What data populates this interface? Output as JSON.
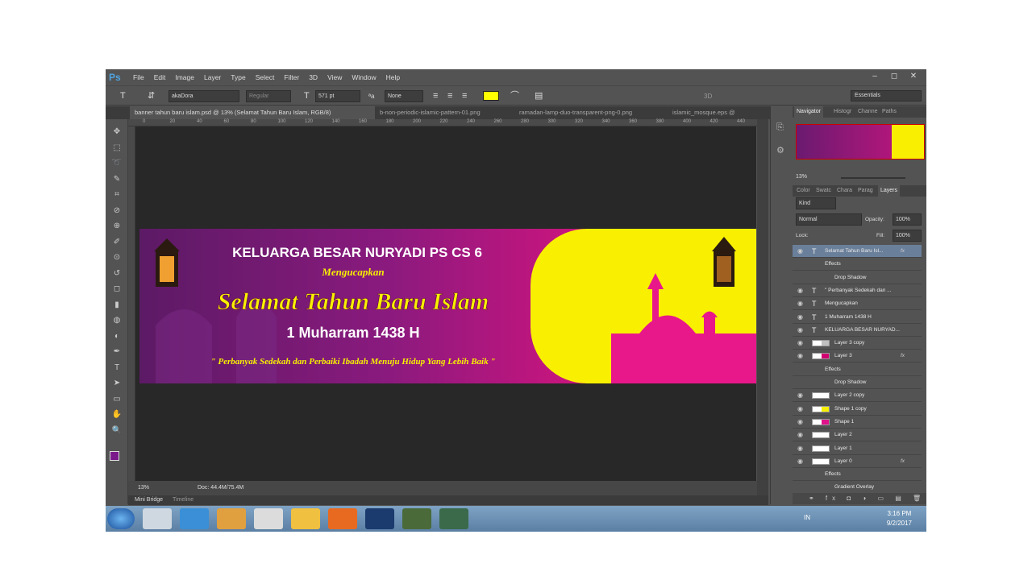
{
  "app": {
    "logo": "Ps"
  },
  "menu": [
    "File",
    "Edit",
    "Image",
    "Layer",
    "Type",
    "Select",
    "Filter",
    "3D",
    "View",
    "Window",
    "Help"
  ],
  "window_controls": [
    "–",
    "◻",
    "✕"
  ],
  "options": {
    "font_family": "akaDora",
    "font_style": "Regular",
    "font_size": "571 pt",
    "antialias": "None",
    "three_d": "3D",
    "workspace": "Essentials",
    "text_color": "#ffff00"
  },
  "doc_tabs": [
    "banner tahun baru islam.psd @ 13% (Selamat Tahun Baru Islam, RGB/8)",
    "b-non-periodic-islamic-pattern-01.png",
    "ramadan-lamp-duo-transparent-png-0.png",
    "islamic_mosque.eps @"
  ],
  "ruler_ticks": [
    "0",
    "20",
    "40",
    "60",
    "80",
    "100",
    "120",
    "140",
    "160",
    "180",
    "200",
    "220",
    "240",
    "260",
    "280",
    "300",
    "320",
    "340",
    "360",
    "380",
    "400",
    "420",
    "440"
  ],
  "banner": {
    "line1": "KELUARGA BESAR NURYADI PS CS 6",
    "line2": "Mengucapkan",
    "line3": "Selamat Tahun Baru Islam",
    "line4": "1 Muharram 1438 H",
    "line5": "\" Perbanyak Sedekah dan Perbaiki Ibadah Menuju Hidup Yang Lebih Baik \""
  },
  "status": {
    "zoom": "13%",
    "doc": "Doc: 44.4M/75.4M"
  },
  "bottom_tabs": [
    "Mini Bridge",
    "Timeline"
  ],
  "navigator": {
    "tabs": [
      "Navigator",
      "Histogr",
      "Channe",
      "Paths"
    ],
    "zoom": "13%"
  },
  "layers_panel": {
    "tabs": [
      "Color",
      "Swatc",
      "Chara",
      "Parag",
      "Layers"
    ],
    "kind": "Kind",
    "blend": "Normal",
    "opacity_label": "Opacity:",
    "opacity": "100%",
    "lock_label": "Lock:",
    "fill_label": "Fill:",
    "fill": "100%",
    "layers": [
      {
        "name": "Selamat Tahun Baru Isl...",
        "type": "text",
        "fx": "fx",
        "indent": 0,
        "selected": true
      },
      {
        "name": "Effects",
        "type": "effect",
        "fx": "",
        "indent": 1
      },
      {
        "name": "Drop Shadow",
        "type": "effect",
        "fx": "",
        "indent": 2
      },
      {
        "name": "\" Perbanyak Sedekah dan ...",
        "type": "text",
        "fx": "",
        "indent": 0
      },
      {
        "name": "Mengucapkan",
        "type": "text",
        "fx": "",
        "indent": 0
      },
      {
        "name": "1 Muharram 1438 H",
        "type": "text",
        "fx": "",
        "indent": 0
      },
      {
        "name": "KELUARGA BESAR NURYAD...",
        "type": "text",
        "fx": "",
        "indent": 0
      },
      {
        "name": "Layer 3 copy",
        "type": "image",
        "fx": "",
        "indent": 0
      },
      {
        "name": "Layer 3",
        "type": "image",
        "fx": "fx",
        "indent": 0
      },
      {
        "name": "Effects",
        "type": "effect",
        "fx": "",
        "indent": 1
      },
      {
        "name": "Drop Shadow",
        "type": "effect",
        "fx": "",
        "indent": 2
      },
      {
        "name": "Layer 2 copy",
        "type": "image",
        "fx": "",
        "indent": 0
      },
      {
        "name": "Shape 1 copy",
        "type": "image",
        "fx": "",
        "indent": 0
      },
      {
        "name": "Shape 1",
        "type": "image",
        "fx": "",
        "indent": 0
      },
      {
        "name": "Layer 2",
        "type": "image",
        "fx": "",
        "indent": 0
      },
      {
        "name": "Layer 1",
        "type": "image",
        "fx": "",
        "indent": 0
      },
      {
        "name": "Layer 0",
        "type": "image",
        "fx": "fx",
        "indent": 0
      },
      {
        "name": "Effects",
        "type": "effect",
        "fx": "",
        "indent": 1
      },
      {
        "name": "Gradient Overlay",
        "type": "effect",
        "fx": "",
        "indent": 2
      }
    ]
  },
  "taskbar": {
    "lang": "IN",
    "time": "3:16 PM",
    "date": "9/2/2017"
  }
}
